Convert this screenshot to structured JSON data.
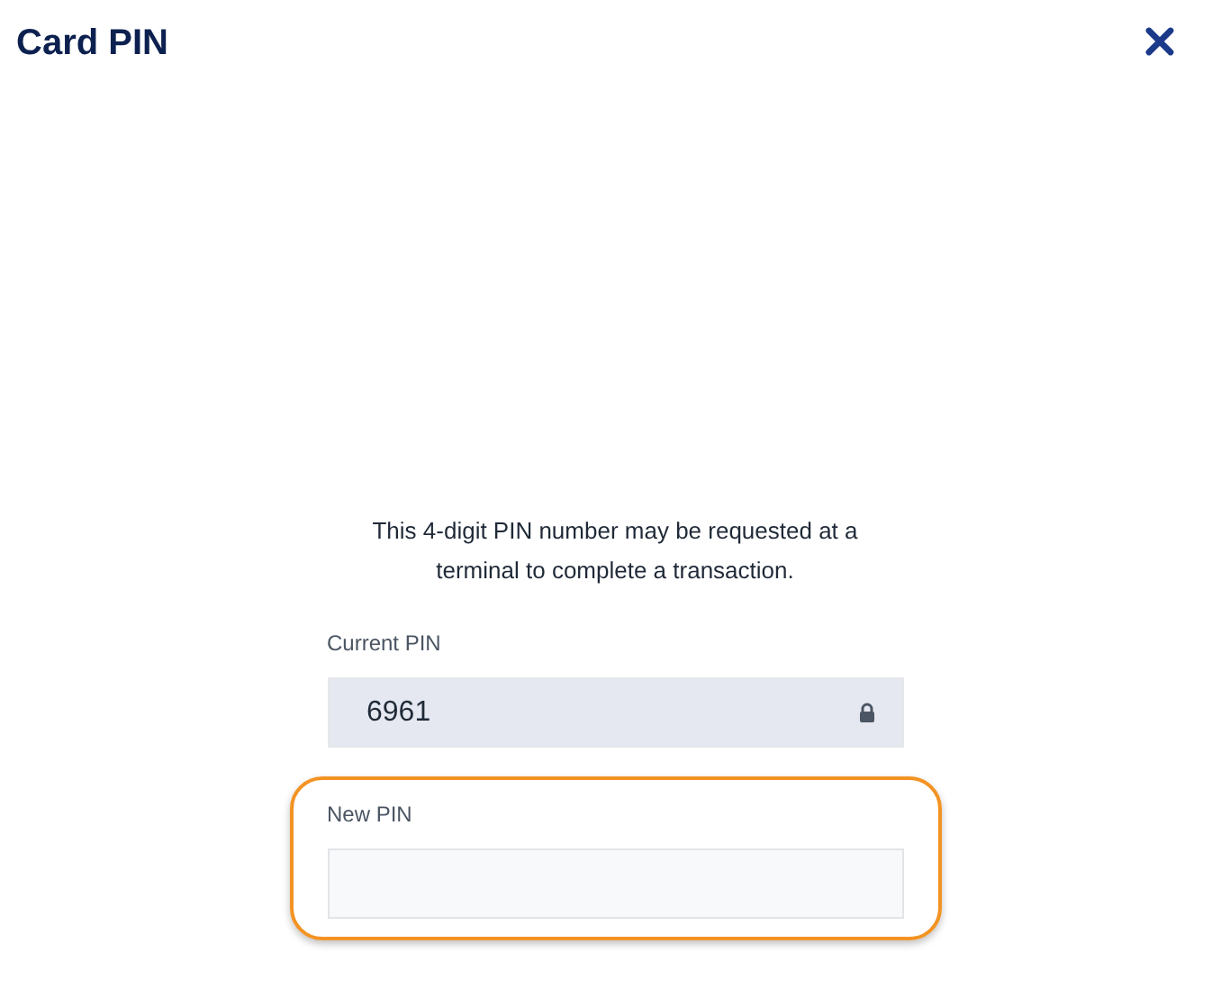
{
  "dialog": {
    "title": "Card PIN"
  },
  "description": "This 4-digit PIN number may be requested at a terminal to complete a transaction.",
  "fields": [
    {
      "label": "Current PIN",
      "value": "6961",
      "locked": true,
      "highlighted": false
    },
    {
      "label": "New PIN",
      "locked": false,
      "highlighted": true
    }
  ]
}
